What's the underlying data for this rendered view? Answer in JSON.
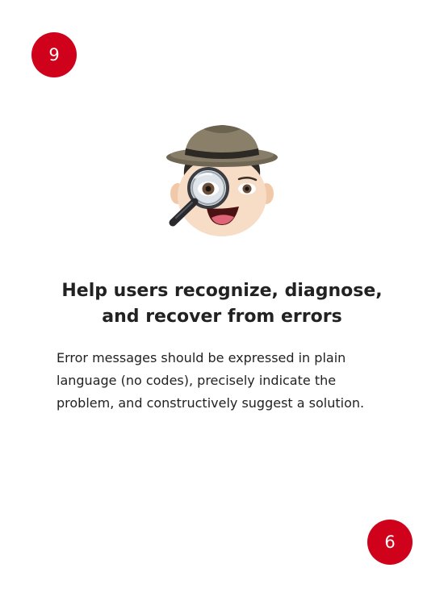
{
  "card": {
    "number_top": "9",
    "number_bottom": "6",
    "title_lines": [
      "Help users recognize, diagnose,",
      "and recover from errors"
    ],
    "description_lines": [
      "Error messages should be expressed in plain",
      "language (no codes), precisely indicate the",
      "problem, and constructively suggest a solution."
    ],
    "illustration_icon": "detective-with-magnifying-glass-icon"
  },
  "colors": {
    "badge": "#d0021b",
    "badge_text": "#ffffff",
    "text": "#222222",
    "background": "#ffffff"
  }
}
